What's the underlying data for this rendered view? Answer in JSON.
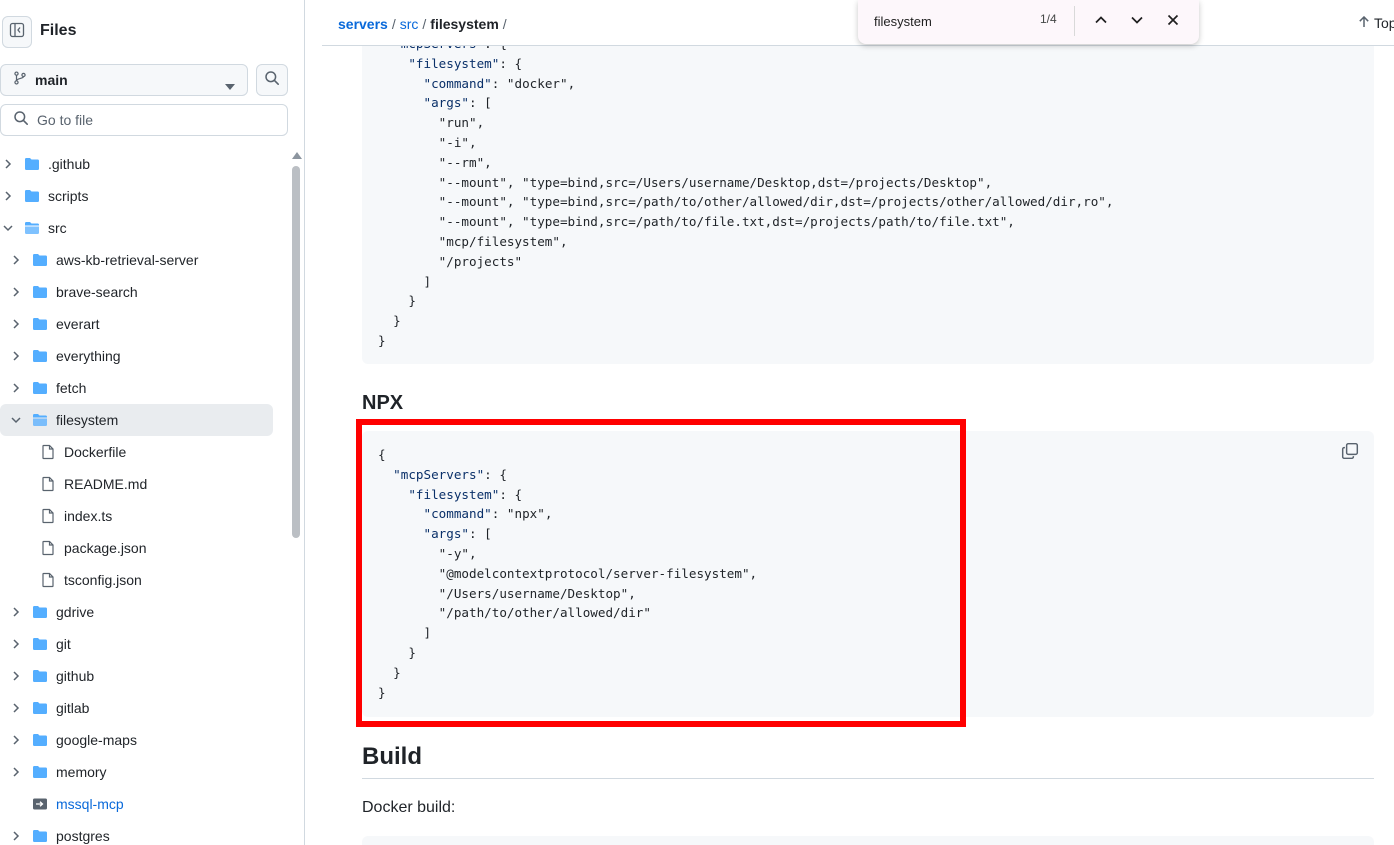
{
  "sidebar": {
    "title": "Files",
    "branch": "main",
    "goto_placeholder": "Go to file",
    "tree": [
      {
        "name": ".github",
        "type": "folder",
        "depth": 0,
        "expanded": false
      },
      {
        "name": "scripts",
        "type": "folder",
        "depth": 0,
        "expanded": false
      },
      {
        "name": "src",
        "type": "folder",
        "depth": 0,
        "expanded": true
      },
      {
        "name": "aws-kb-retrieval-server",
        "type": "folder",
        "depth": 1,
        "expanded": false
      },
      {
        "name": "brave-search",
        "type": "folder",
        "depth": 1,
        "expanded": false
      },
      {
        "name": "everart",
        "type": "folder",
        "depth": 1,
        "expanded": false
      },
      {
        "name": "everything",
        "type": "folder",
        "depth": 1,
        "expanded": false
      },
      {
        "name": "fetch",
        "type": "folder",
        "depth": 1,
        "expanded": false
      },
      {
        "name": "filesystem",
        "type": "folder",
        "depth": 1,
        "expanded": true,
        "selected": true
      },
      {
        "name": "Dockerfile",
        "type": "file",
        "depth": 2
      },
      {
        "name": "README.md",
        "type": "file",
        "depth": 2
      },
      {
        "name": "index.ts",
        "type": "file",
        "depth": 2
      },
      {
        "name": "package.json",
        "type": "file",
        "depth": 2
      },
      {
        "name": "tsconfig.json",
        "type": "file",
        "depth": 2
      },
      {
        "name": "gdrive",
        "type": "folder",
        "depth": 1,
        "expanded": false
      },
      {
        "name": "git",
        "type": "folder",
        "depth": 1,
        "expanded": false
      },
      {
        "name": "github",
        "type": "folder",
        "depth": 1,
        "expanded": false
      },
      {
        "name": "gitlab",
        "type": "folder",
        "depth": 1,
        "expanded": false
      },
      {
        "name": "google-maps",
        "type": "folder",
        "depth": 1,
        "expanded": false
      },
      {
        "name": "memory",
        "type": "folder",
        "depth": 1,
        "expanded": false
      },
      {
        "name": "mssql-mcp",
        "type": "submodule",
        "depth": 1
      },
      {
        "name": "postgres",
        "type": "folder",
        "depth": 1,
        "expanded": false
      }
    ]
  },
  "breadcrumb": {
    "root": "servers",
    "mid": "src",
    "current": "filesystem",
    "trailing": "/"
  },
  "top_link": "Top",
  "find": {
    "query": "filesystem",
    "count": "1/4"
  },
  "content": {
    "code_docker": [
      "  \"mcpServers\": {",
      "    \"filesystem\": {",
      "      \"command\": \"docker\",",
      "      \"args\": [",
      "        \"run\",",
      "        \"-i\",",
      "        \"--rm\",",
      "        \"--mount\", \"type=bind,src=/Users/username/Desktop,dst=/projects/Desktop\",",
      "        \"--mount\", \"type=bind,src=/path/to/other/allowed/dir,dst=/projects/other/allowed/dir,ro\",",
      "        \"--mount\", \"type=bind,src=/path/to/file.txt,dst=/projects/path/to/file.txt\",",
      "        \"mcp/filesystem\",",
      "        \"/projects\"",
      "      ]",
      "    }",
      "  }",
      "}"
    ],
    "npx_heading": "NPX",
    "code_npx": [
      "{",
      "  \"mcpServers\": {",
      "    \"filesystem\": {",
      "      \"command\": \"npx\",",
      "      \"args\": [",
      "        \"-y\",",
      "        \"@modelcontextprotocol/server-filesystem\",",
      "        \"/Users/username/Desktop\",",
      "        \"/path/to/other/allowed/dir\"",
      "      ]",
      "    }",
      "  }",
      "}"
    ],
    "build_heading": "Build",
    "docker_build_text": "Docker build:"
  },
  "colors": {
    "link": "#0969da",
    "code_bg": "#f6f8fa",
    "highlight_border": "#ff0000",
    "json_key": "#0a3069",
    "folder": "#54aeff"
  }
}
